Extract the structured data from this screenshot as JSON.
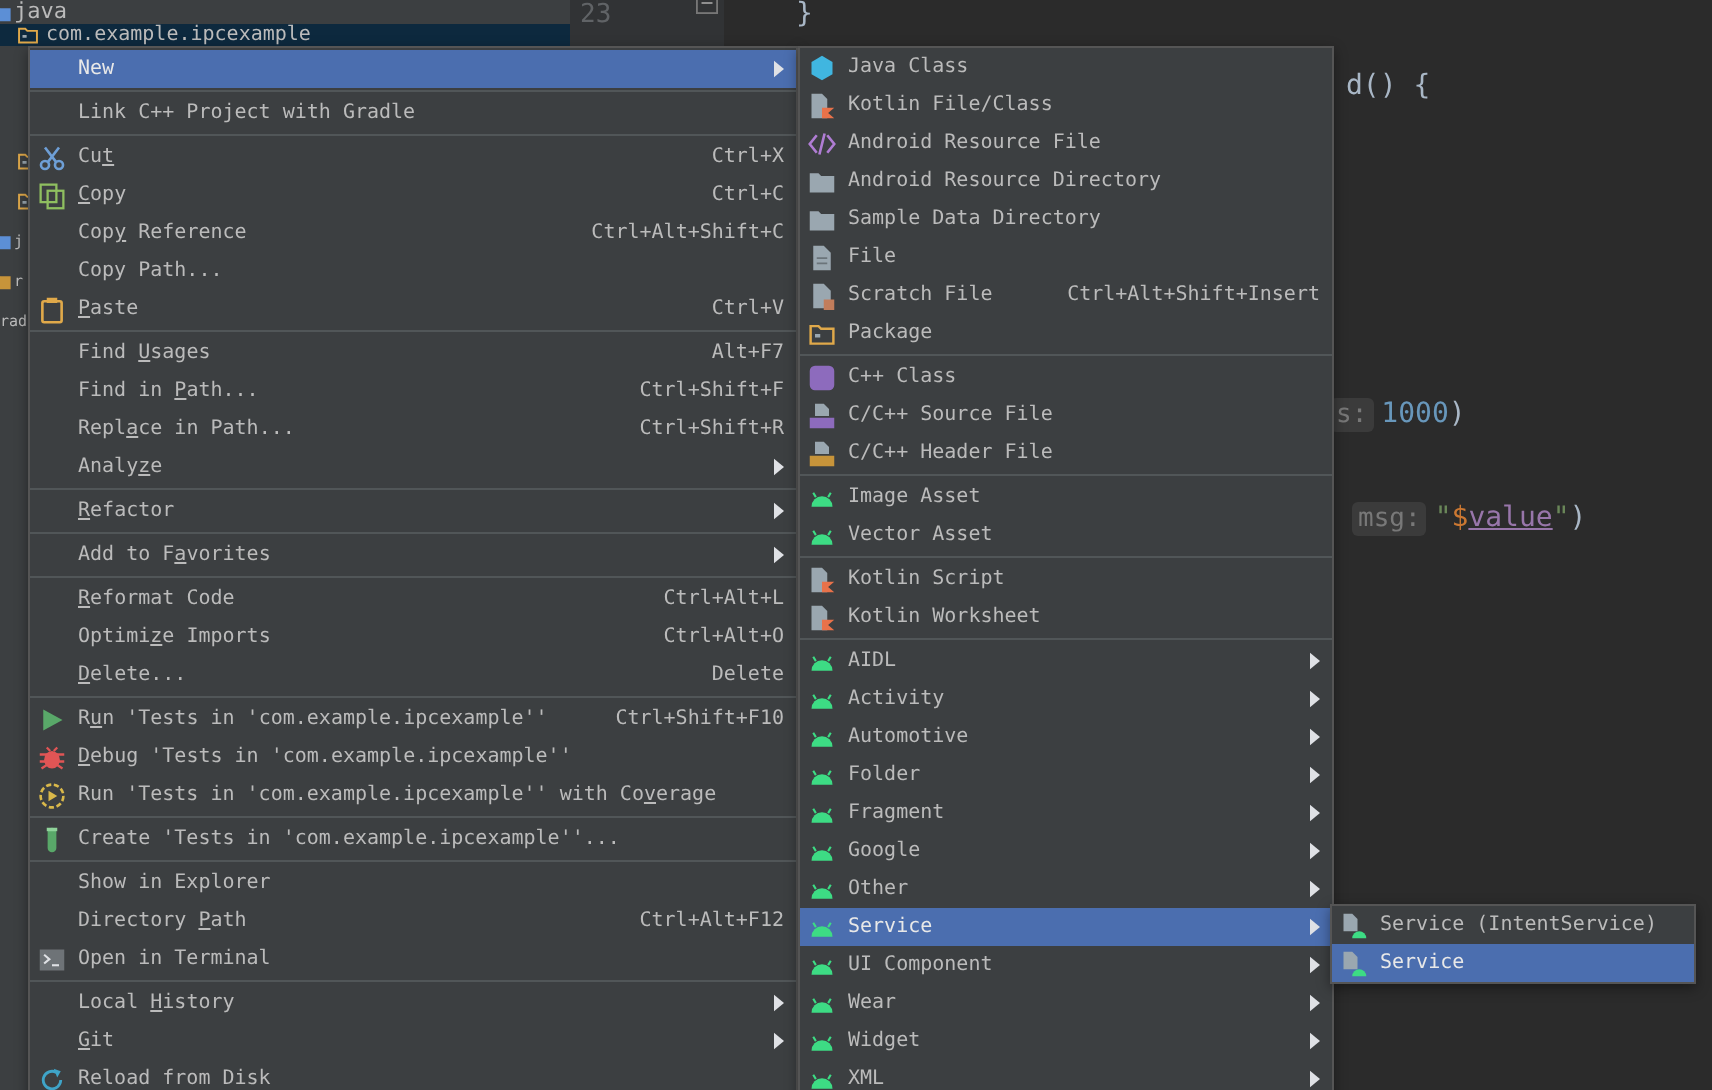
{
  "project_tree": [
    {
      "label": "java",
      "kind": "source-folder",
      "selected": false,
      "children": [
        {
          "label": "com.example.ipcexample",
          "kind": "package",
          "selected": true
        },
        {
          "kind": "package",
          "selected": false
        },
        {
          "kind": "package",
          "selected": false
        }
      ]
    },
    {
      "label": "j",
      "kind": "source-folder",
      "selected": false
    },
    {
      "label": "r",
      "kind": "res-folder",
      "selected": false
    },
    {
      "label": "rad",
      "selected": false
    }
  ],
  "gutter": {
    "line_numbers": [
      "23"
    ]
  },
  "code_lines": [
    {
      "tokens": [
        {
          "kind": "plain",
          "text": "}"
        }
      ]
    },
    {
      "tokens": [
        {
          "kind": "plain",
          "text": "d() {"
        }
      ]
    },
    {
      "tokens": [
        {
          "kind": "hint",
          "text": "s:"
        },
        {
          "kind": "number",
          "text": "1000"
        },
        {
          "kind": "plain",
          "text": ")"
        }
      ]
    },
    {
      "tokens": [
        {
          "kind": "hint",
          "text": "msg:"
        },
        {
          "kind": "string",
          "text": "\""
        },
        {
          "kind": "template",
          "text": "$"
        },
        {
          "kind": "field",
          "text": "value"
        },
        {
          "kind": "string",
          "text": "\""
        },
        {
          "kind": "plain",
          "text": ")"
        }
      ]
    }
  ],
  "context_menu": {
    "groups": [
      {
        "items": [
          {
            "label": {
              "pre": "New"
            },
            "submenu": true,
            "selected": true
          }
        ]
      },
      {
        "items": [
          {
            "label": {
              "pre": "Link C++ Project with Gradle"
            },
            "submenu": false,
            "selected": false
          }
        ]
      },
      {
        "items": [
          {
            "label": {
              "pre": "Cu",
              "key": "t"
            },
            "kind": "scissors",
            "shortcut": "Ctrl+X",
            "submenu": false,
            "selected": false
          },
          {
            "label": {
              "key": "C",
              "post": "opy"
            },
            "kind": "copy",
            "shortcut": "Ctrl+C",
            "submenu": false,
            "selected": false
          },
          {
            "label": {
              "pre": "Cop",
              "key": "y",
              "post": " Reference"
            },
            "shortcut": "Ctrl+Alt+Shift+C",
            "submenu": false,
            "selected": false
          },
          {
            "label": {
              "pre": "Copy Path..."
            },
            "submenu": false,
            "selected": false
          },
          {
            "label": {
              "key": "P",
              "post": "aste"
            },
            "kind": "paste",
            "shortcut": "Ctrl+V",
            "submenu": false,
            "selected": false
          }
        ]
      },
      {
        "items": [
          {
            "label": {
              "pre": "Find ",
              "key": "U",
              "post": "sages"
            },
            "shortcut": "Alt+F7",
            "submenu": false,
            "selected": false
          },
          {
            "label": {
              "pre": "Find in ",
              "key": "P",
              "post": "ath..."
            },
            "shortcut": "Ctrl+Shift+F",
            "submenu": false,
            "selected": false
          },
          {
            "label": {
              "pre": "Repl",
              "key": "a",
              "post": "ce in Path..."
            },
            "shortcut": "Ctrl+Shift+R",
            "submenu": false,
            "selected": false
          },
          {
            "label": {
              "pre": "Analy",
              "key": "z",
              "post": "e"
            },
            "submenu": true,
            "selected": false
          }
        ]
      },
      {
        "items": [
          {
            "label": {
              "key": "R",
              "post": "efactor"
            },
            "submenu": true,
            "selected": false
          }
        ]
      },
      {
        "items": [
          {
            "label": {
              "pre": "Add to F",
              "key": "a",
              "post": "vorites"
            },
            "submenu": true,
            "selected": false
          }
        ]
      },
      {
        "items": [
          {
            "label": {
              "key": "R",
              "post": "eformat Code"
            },
            "shortcut": "Ctrl+Alt+L",
            "submenu": false,
            "selected": false
          },
          {
            "label": {
              "pre": "Optimi",
              "key": "z",
              "post": "e Imports"
            },
            "shortcut": "Ctrl+Alt+O",
            "submenu": false,
            "selected": false
          },
          {
            "label": {
              "key": "D",
              "post": "elete..."
            },
            "shortcut": "Delete",
            "submenu": false,
            "selected": false
          }
        ]
      },
      {
        "items": [
          {
            "label": {
              "pre": "R",
              "key": "u",
              "post": "n 'Tests in 'com.example.ipcexample''"
            },
            "kind": "run",
            "shortcut": "Ctrl+Shift+F10",
            "submenu": false,
            "selected": false
          },
          {
            "label": {
              "key": "D",
              "post": "ebug 'Tests in 'com.example.ipcexample''"
            },
            "kind": "debug",
            "submenu": false,
            "selected": false
          },
          {
            "label": {
              "pre": "Run 'Tests in 'com.example.ipcexample'' with Co",
              "key": "v",
              "post": "erage"
            },
            "kind": "coverage",
            "submenu": false,
            "selected": false
          }
        ]
      },
      {
        "items": [
          {
            "label": {
              "pre": "Create 'Tests in 'com.example.ipcexample''..."
            },
            "kind": "test",
            "submenu": false,
            "selected": false
          }
        ]
      },
      {
        "items": [
          {
            "label": {
              "pre": "Show in Explorer"
            },
            "submenu": false,
            "selected": false
          },
          {
            "label": {
              "pre": "Directory ",
              "key": "P",
              "post": "ath"
            },
            "shortcut": "Ctrl+Alt+F12",
            "submenu": false,
            "selected": false
          },
          {
            "label": {
              "pre": "Open in Terminal"
            },
            "kind": "terminal",
            "submenu": false,
            "selected": false
          }
        ]
      },
      {
        "items": [
          {
            "label": {
              "pre": "Local ",
              "key": "H",
              "post": "istory"
            },
            "submenu": true,
            "selected": false
          },
          {
            "label": {
              "key": "G",
              "post": "it"
            },
            "submenu": true,
            "selected": false
          },
          {
            "label": {
              "pre": "Reload from Disk"
            },
            "kind": "reload",
            "submenu": false,
            "selected": false
          }
        ]
      }
    ]
  },
  "new_submenu": {
    "groups": [
      {
        "items": [
          {
            "label": {
              "pre": "Java Class"
            },
            "kind": "java-class",
            "submenu": false,
            "selected": false
          },
          {
            "label": {
              "pre": "Kotlin File/Class"
            },
            "kind": "kotlin-file",
            "submenu": false,
            "selected": false
          },
          {
            "label": {
              "pre": "Android Resource File"
            },
            "kind": "code",
            "submenu": false,
            "selected": false
          },
          {
            "label": {
              "pre": "Android Resource Directory"
            },
            "kind": "folder",
            "submenu": false,
            "selected": false
          },
          {
            "label": {
              "pre": "Sample Data Directory"
            },
            "kind": "folder",
            "submenu": false,
            "selected": false
          },
          {
            "label": {
              "pre": "File"
            },
            "kind": "file",
            "submenu": false,
            "selected": false
          },
          {
            "label": {
              "pre": "Scratch File"
            },
            "kind": "scratch",
            "shortcut": "Ctrl+Alt+Shift+Insert",
            "submenu": false,
            "selected": false
          },
          {
            "label": {
              "pre": "Package"
            },
            "kind": "package",
            "submenu": false,
            "selected": false
          }
        ]
      },
      {
        "items": [
          {
            "label": {
              "pre": "C++ Class"
            },
            "kind": "cpp-class",
            "submenu": false,
            "selected": false
          },
          {
            "label": {
              "pre": "C/C++ Source File"
            },
            "kind": "cpp-source",
            "submenu": false,
            "selected": false
          },
          {
            "label": {
              "pre": "C/C++ Header File"
            },
            "kind": "cpp-header",
            "submenu": false,
            "selected": false
          }
        ]
      },
      {
        "items": [
          {
            "label": {
              "pre": "Image Asset"
            },
            "kind": "android",
            "submenu": false,
            "selected": false
          },
          {
            "label": {
              "pre": "Vector Asset"
            },
            "kind": "android",
            "submenu": false,
            "selected": false
          }
        ]
      },
      {
        "items": [
          {
            "label": {
              "pre": "Kotlin Script"
            },
            "kind": "kotlin-file",
            "submenu": false,
            "selected": false
          },
          {
            "label": {
              "pre": "Kotlin Worksheet"
            },
            "kind": "kotlin-file",
            "submenu": false,
            "selected": false
          }
        ]
      },
      {
        "items": [
          {
            "label": {
              "pre": "AIDL"
            },
            "kind": "android",
            "submenu": true,
            "selected": false
          },
          {
            "label": {
              "pre": "Activity"
            },
            "kind": "android",
            "submenu": true,
            "selected": false
          },
          {
            "label": {
              "pre": "Automotive"
            },
            "kind": "android",
            "submenu": true,
            "selected": false
          },
          {
            "label": {
              "pre": "Folder"
            },
            "kind": "android",
            "submenu": true,
            "selected": false
          },
          {
            "label": {
              "pre": "Fragment"
            },
            "kind": "android",
            "submenu": true,
            "selected": false
          },
          {
            "label": {
              "pre": "Google"
            },
            "kind": "android",
            "submenu": true,
            "selected": false
          },
          {
            "label": {
              "pre": "Other"
            },
            "kind": "android",
            "submenu": true,
            "selected": false
          },
          {
            "label": {
              "pre": "Service"
            },
            "kind": "android",
            "submenu": true,
            "selected": true
          },
          {
            "label": {
              "pre": "UI Component"
            },
            "kind": "android",
            "submenu": true,
            "selected": false
          },
          {
            "label": {
              "pre": "Wear"
            },
            "kind": "android",
            "submenu": true,
            "selected": false
          },
          {
            "label": {
              "pre": "Widget"
            },
            "kind": "android",
            "submenu": true,
            "selected": false
          },
          {
            "label": {
              "pre": "XML"
            },
            "kind": "android",
            "submenu": true,
            "selected": false
          }
        ]
      }
    ]
  },
  "service_submenu": {
    "items": [
      {
        "label": {
          "pre": "Service (IntentService)"
        },
        "kind": "service",
        "submenu": false,
        "selected": false
      },
      {
        "label": {
          "pre": "Service"
        },
        "kind": "service",
        "submenu": false,
        "selected": true
      }
    ]
  }
}
